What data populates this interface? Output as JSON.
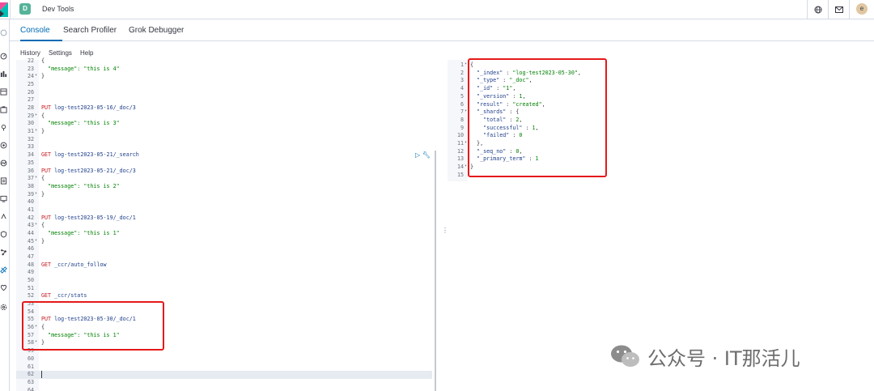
{
  "header": {
    "space_initial": "D",
    "app_title": "Dev Tools",
    "user_initial": "e"
  },
  "tabs": [
    {
      "label": "Console"
    },
    {
      "label": "Search Profiler"
    },
    {
      "label": "Grok Debugger"
    }
  ],
  "toolbar": {
    "history": "History",
    "settings": "Settings",
    "help": "Help"
  },
  "editor": {
    "lines": [
      {
        "n": "22",
        "fold": "",
        "t": "{",
        "k": "plain"
      },
      {
        "n": "23",
        "fold": "",
        "t": "  \"message\": \"this is 4\"",
        "k": "kv"
      },
      {
        "n": "24",
        "fold": "▾",
        "t": "}",
        "k": "plain"
      },
      {
        "n": "25",
        "fold": "",
        "t": "",
        "k": "plain"
      },
      {
        "n": "26",
        "fold": "",
        "t": "",
        "k": "plain"
      },
      {
        "n": "27",
        "fold": "",
        "t": "",
        "k": "plain"
      },
      {
        "n": "28",
        "fold": "",
        "m": "PUT",
        "p": " log-test2023-05-16/_doc/3",
        "k": "req"
      },
      {
        "n": "29",
        "fold": "▾",
        "t": "{",
        "k": "plain"
      },
      {
        "n": "30",
        "fold": "",
        "t": "  \"message\": \"this is 3\"",
        "k": "kv"
      },
      {
        "n": "31",
        "fold": "▾",
        "t": "}",
        "k": "plain"
      },
      {
        "n": "32",
        "fold": "",
        "t": "",
        "k": "plain"
      },
      {
        "n": "33",
        "fold": "",
        "t": "",
        "k": "plain"
      },
      {
        "n": "34",
        "fold": "",
        "m": "GET",
        "p": " log-test2023-05-21/_search",
        "k": "req"
      },
      {
        "n": "35",
        "fold": "",
        "t": "",
        "k": "plain"
      },
      {
        "n": "36",
        "fold": "",
        "m": "PUT",
        "p": " log-test2023-05-21/_doc/3",
        "k": "req"
      },
      {
        "n": "37",
        "fold": "▾",
        "t": "{",
        "k": "plain"
      },
      {
        "n": "38",
        "fold": "",
        "t": "  \"message\": \"this is 2\"",
        "k": "kv"
      },
      {
        "n": "39",
        "fold": "▾",
        "t": "}",
        "k": "plain"
      },
      {
        "n": "40",
        "fold": "",
        "t": "",
        "k": "plain"
      },
      {
        "n": "41",
        "fold": "",
        "t": "",
        "k": "plain"
      },
      {
        "n": "42",
        "fold": "",
        "m": "PUT",
        "p": " log-test2023-05-19/_doc/1",
        "k": "req"
      },
      {
        "n": "43",
        "fold": "▾",
        "t": "{",
        "k": "plain"
      },
      {
        "n": "44",
        "fold": "",
        "t": "  \"message\": \"this is 1\"",
        "k": "kv"
      },
      {
        "n": "45",
        "fold": "▾",
        "t": "}",
        "k": "plain"
      },
      {
        "n": "46",
        "fold": "",
        "t": "",
        "k": "plain"
      },
      {
        "n": "47",
        "fold": "",
        "t": "",
        "k": "plain"
      },
      {
        "n": "48",
        "fold": "",
        "m": "GET",
        "p": " _ccr/auto_follow",
        "k": "req"
      },
      {
        "n": "49",
        "fold": "",
        "t": "",
        "k": "plain"
      },
      {
        "n": "50",
        "fold": "",
        "t": "",
        "k": "plain"
      },
      {
        "n": "51",
        "fold": "",
        "t": "",
        "k": "plain"
      },
      {
        "n": "52",
        "fold": "",
        "m": "GET",
        "p": " _ccr/stats",
        "k": "req"
      },
      {
        "n": "53",
        "fold": "",
        "t": "",
        "k": "plain"
      },
      {
        "n": "54",
        "fold": "",
        "t": "",
        "k": "plain"
      },
      {
        "n": "55",
        "fold": "",
        "m": "PUT",
        "p": " log-test2023-05-30/_doc/1",
        "k": "req"
      },
      {
        "n": "56",
        "fold": "▾",
        "t": "{",
        "k": "plain"
      },
      {
        "n": "57",
        "fold": "",
        "t": "  \"message\": \"this is 1\"",
        "k": "kv"
      },
      {
        "n": "58",
        "fold": "▾",
        "t": "}",
        "k": "plain"
      },
      {
        "n": "59",
        "fold": "",
        "t": "",
        "k": "plain"
      },
      {
        "n": "60",
        "fold": "",
        "t": "",
        "k": "plain"
      },
      {
        "n": "61",
        "fold": "",
        "t": "",
        "k": "plain"
      },
      {
        "n": "62",
        "fold": "",
        "t": "",
        "k": "plain"
      },
      {
        "n": "63",
        "fold": "",
        "t": "",
        "k": "plain"
      },
      {
        "n": "64",
        "fold": "",
        "t": "",
        "k": "plain"
      }
    ]
  },
  "output": {
    "lines": [
      {
        "n": "1",
        "fold": "▾",
        "t": "{"
      },
      {
        "n": "2",
        "fold": "",
        "key": "  \"_index\"",
        "sep": " : ",
        "val": "\"log-test2023-05-30\"",
        "end": ","
      },
      {
        "n": "3",
        "fold": "",
        "key": "  \"_type\"",
        "sep": " : ",
        "val": "\"_doc\"",
        "end": ","
      },
      {
        "n": "4",
        "fold": "",
        "key": "  \"_id\"",
        "sep": " : ",
        "val": "\"1\"",
        "end": ","
      },
      {
        "n": "5",
        "fold": "",
        "key": "  \"_version\"",
        "sep": " : ",
        "val": "1",
        "end": ","
      },
      {
        "n": "6",
        "fold": "",
        "key": "  \"result\"",
        "sep": " : ",
        "val": "\"created\"",
        "end": ","
      },
      {
        "n": "7",
        "fold": "▾",
        "key": "  \"_shards\"",
        "sep": " : ",
        "val": "",
        "end": "{"
      },
      {
        "n": "8",
        "fold": "",
        "key": "    \"total\"",
        "sep": " : ",
        "val": "2",
        "end": ","
      },
      {
        "n": "9",
        "fold": "",
        "key": "    \"successful\"",
        "sep": " : ",
        "val": "1",
        "end": ","
      },
      {
        "n": "10",
        "fold": "",
        "key": "    \"failed\"",
        "sep": " : ",
        "val": "0",
        "end": ""
      },
      {
        "n": "11",
        "fold": "▾",
        "t": "  },"
      },
      {
        "n": "12",
        "fold": "",
        "key": "  \"_seq_no\"",
        "sep": " : ",
        "val": "0",
        "end": ","
      },
      {
        "n": "13",
        "fold": "",
        "key": "  \"_primary_term\"",
        "sep": " : ",
        "val": "1",
        "end": ""
      },
      {
        "n": "14",
        "fold": "▾",
        "t": "}"
      },
      {
        "n": "15",
        "fold": "",
        "t": ""
      }
    ]
  },
  "watermark": {
    "text": "公众号 · IT那活儿"
  },
  "colors": {
    "accent": "#006bb4",
    "highlight_box": "#e5191a",
    "method": "#c61e25",
    "string": "#008000"
  }
}
